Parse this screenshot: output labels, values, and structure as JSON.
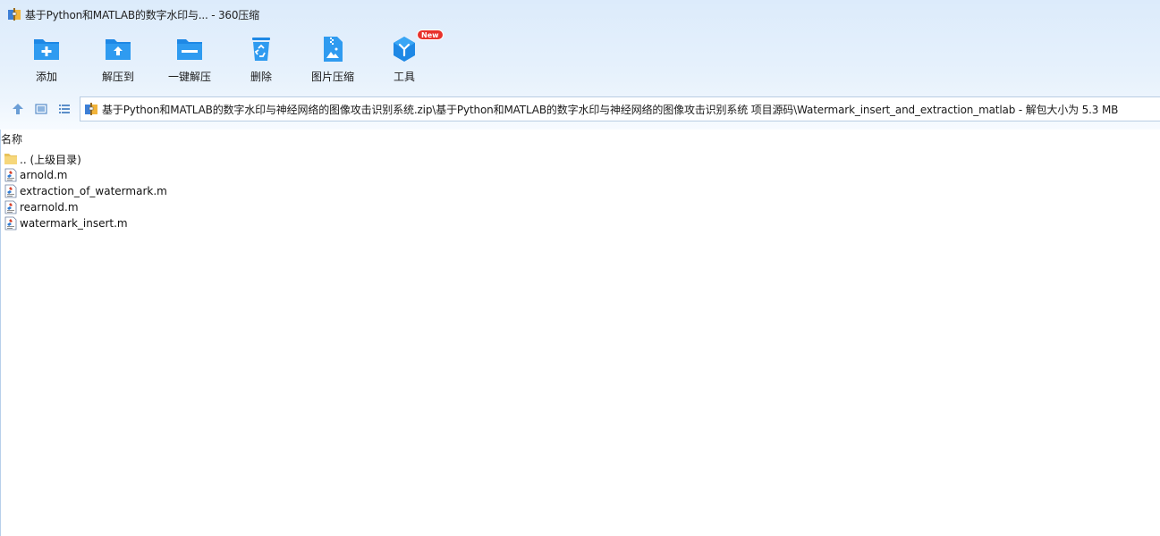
{
  "window": {
    "title": "基于Python和MATLAB的数字水印与... - 360压缩"
  },
  "toolbar": {
    "items": [
      {
        "label": "添加",
        "icon": "folder-add-icon"
      },
      {
        "label": "解压到",
        "icon": "folder-extract-icon"
      },
      {
        "label": "一键解压",
        "icon": "folder-one-click-extract-icon"
      },
      {
        "label": "删除",
        "icon": "recycle-bin-icon"
      },
      {
        "label": "图片压缩",
        "icon": "image-compress-icon"
      },
      {
        "label": "工具",
        "icon": "tools-cube-icon",
        "badge": "New"
      }
    ]
  },
  "nav": {
    "up_icon": "arrow-up-icon",
    "view_icon": "thumbnail-view-icon",
    "list_icon": "list-view-icon",
    "address": "基于Python和MATLAB的数字水印与神经网络的图像攻击识别系统.zip\\基于Python和MATLAB的数字水印与神经网络的图像攻击识别系统 项目源码\\Watermark_insert_and_extraction_matlab - 解包大小为 5.3 MB"
  },
  "list": {
    "column_name": "名称",
    "files": [
      {
        "name": ".. (上级目录)",
        "icon": "folder-icon"
      },
      {
        "name": "arnold.m",
        "icon": "file-icon"
      },
      {
        "name": "extraction_of_watermark.m",
        "icon": "file-icon"
      },
      {
        "name": "rearnold.m",
        "icon": "file-icon"
      },
      {
        "name": "watermark_insert.m",
        "icon": "file-icon"
      }
    ]
  },
  "colors": {
    "accent": "#1a8ce6",
    "badge": "#e8322c",
    "header_bg": "#dcebfb"
  }
}
